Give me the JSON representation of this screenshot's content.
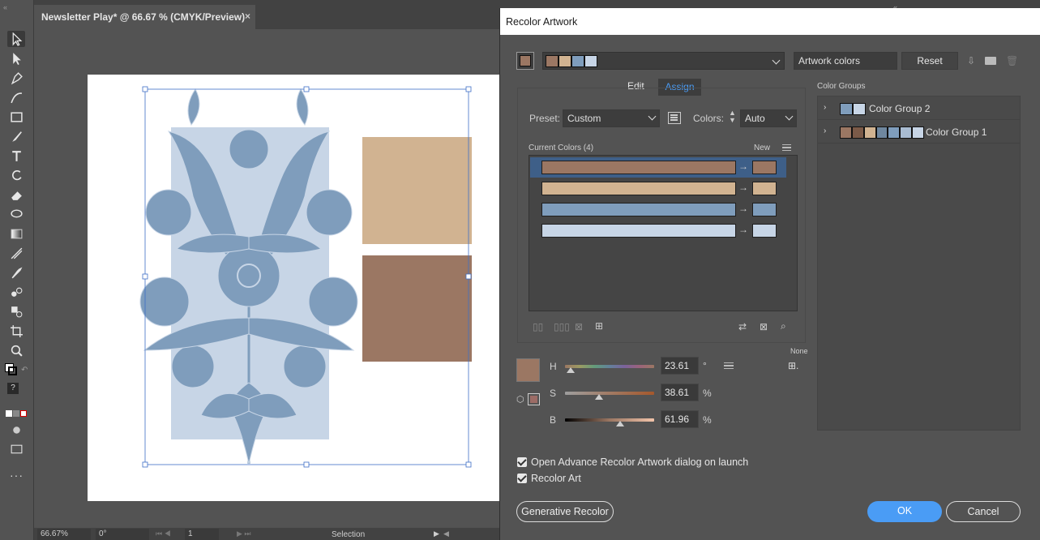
{
  "document": {
    "tab_title": "Newsletter Play* @ 66.67 % (CMYK/Preview)",
    "close": "×"
  },
  "status_bar": {
    "zoom": "66.67%",
    "rotation": "0°",
    "artboard_number": "1",
    "tool_name": "Selection"
  },
  "dialog": {
    "title": "Recolor Artwork",
    "artwork_colors_label": "Artwork colors",
    "reset_label": "Reset",
    "tabs": {
      "edit": "Edit",
      "assign": "Assign"
    },
    "preset_label": "Preset:",
    "preset_value": "Custom",
    "colors_label": "Colors:",
    "colors_value": "Auto",
    "current_colors_label": "Current Colors (4)",
    "new_label": "New",
    "color_rows": [
      {
        "current": "#9b7763",
        "new": "#9b7763"
      },
      {
        "current": "#d1b391",
        "new": "#d1b391"
      },
      {
        "current": "#7f9dbc",
        "new": "#7f9dbc"
      },
      {
        "current": "#c7d5e6",
        "new": "#c7d5e6"
      }
    ],
    "none_label": "None",
    "hsb": {
      "h_label": "H",
      "h_value": "23.61",
      "h_unit": "°",
      "s_label": "S",
      "s_value": "38.61",
      "s_unit": "%",
      "b_label": "B",
      "b_value": "61.96",
      "b_unit": "%",
      "h_fraction": 0.066,
      "s_fraction": 0.386,
      "b_fraction": 0.62
    },
    "active_color": "#9b7763",
    "color_groups_label": "Color Groups",
    "color_groups": [
      {
        "name": "Color Group 2"
      },
      {
        "name": "Color Group 1"
      }
    ],
    "checkbox_advance_label": "Open Advance Recolor Artwork dialog on launch",
    "checkbox_recolor_label": "Recolor Art",
    "generative_recolor_label": "Generative Recolor",
    "ok_label": "OK",
    "cancel_label": "Cancel"
  },
  "colors": {
    "brown": "#9b7763",
    "tan": "#d1b391",
    "blue": "#7f9dbc",
    "light_blue": "#c7d5e6",
    "accent": "#4a9cf5"
  }
}
